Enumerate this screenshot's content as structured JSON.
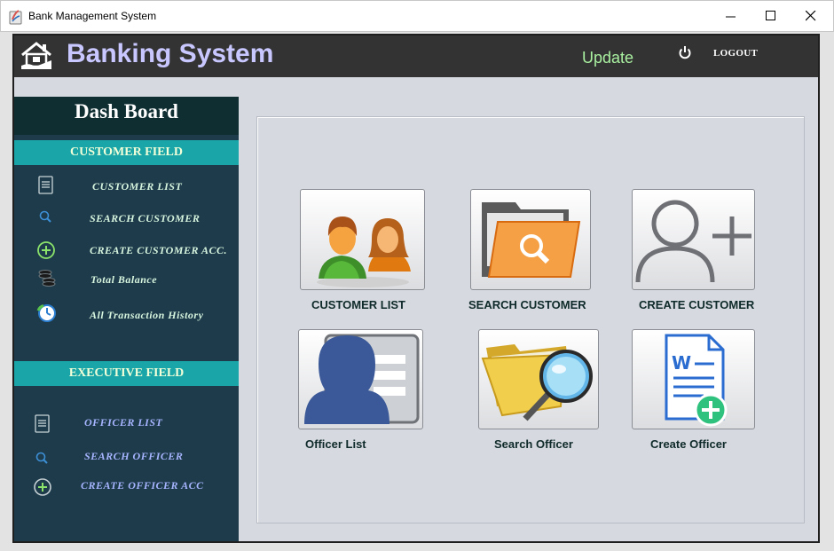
{
  "window": {
    "title": "Bank Management System",
    "controls": {
      "minimize": "minimize-icon",
      "maximize": "maximize-icon",
      "close": "close-icon"
    }
  },
  "header": {
    "brand": "Banking System",
    "update_label": "Update",
    "logout_label": "LOGOUT"
  },
  "sidebar": {
    "title": "Dash Board",
    "customer_section": "CUSTOMER FIELD",
    "customer_items": [
      {
        "label": "CUSTOMER LIST",
        "icon": "list-icon"
      },
      {
        "label": "SEARCH CUSTOMER",
        "icon": "search-icon"
      },
      {
        "label": "CREATE CUSTOMER ACC.",
        "icon": "add-circle-icon"
      },
      {
        "label": "Total Balance",
        "icon": "coins-icon"
      },
      {
        "label": "All Transaction History",
        "icon": "history-icon"
      }
    ],
    "executive_section": "EXECUTIVE FIELD",
    "executive_items": [
      {
        "label": "OFFICER LIST",
        "icon": "list-icon"
      },
      {
        "label": "SEARCH OFFICER",
        "icon": "search-icon"
      },
      {
        "label": "CREATE OFFICER ACC",
        "icon": "add-circle-icon"
      }
    ]
  },
  "tiles": [
    {
      "label": "CUSTOMER LIST",
      "icon": "customers-icon"
    },
    {
      "label": "SEARCH CUSTOMER",
      "icon": "folder-search-icon"
    },
    {
      "label": "CREATE CUSTOMER",
      "icon": "add-user-icon"
    },
    {
      "label": "Officer List",
      "icon": "id-card-icon"
    },
    {
      "label": "Search Officer",
      "icon": "folder-magnifier-icon"
    },
    {
      "label": "Create Officer",
      "icon": "new-document-icon"
    }
  ],
  "colors": {
    "header_bg": "#333333",
    "brand_text": "#c9c7ff",
    "update_text": "#a9f0a0",
    "sidebar_bg": "#1d3b4a",
    "section_bar": "#1aa6a8",
    "panel_bg": "#d6d9df"
  }
}
